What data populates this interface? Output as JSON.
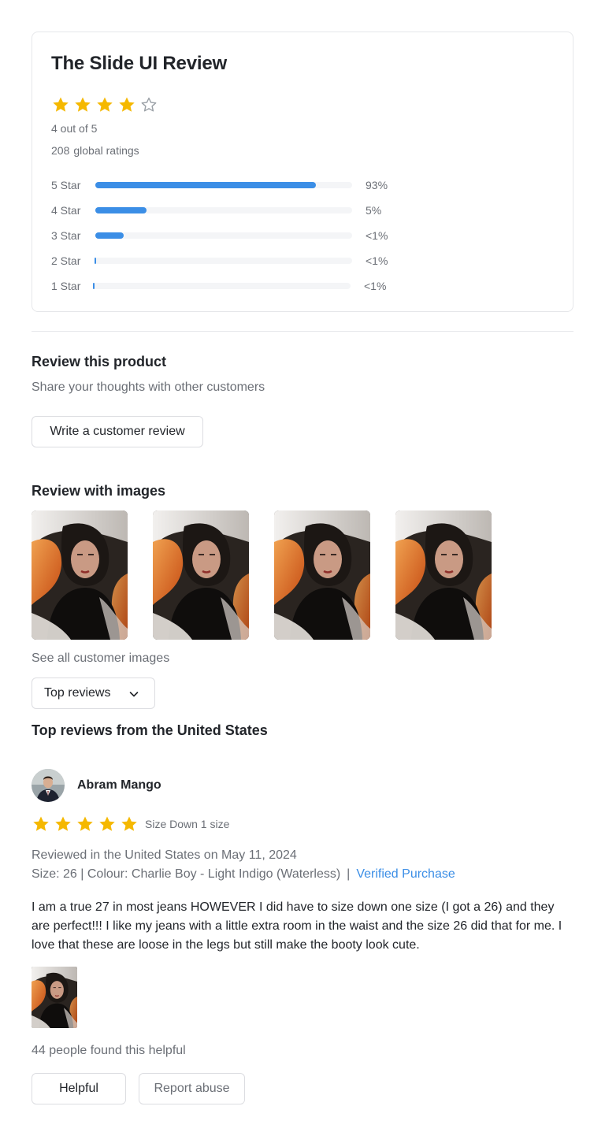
{
  "summary": {
    "title": "The Slide UI Review",
    "rating": 4,
    "max_rating": 5,
    "rating_text": "4 out of 5",
    "ratings_count": "208",
    "ratings_suffix": "global ratings",
    "star_color": "#f5b800",
    "bars": [
      {
        "label": "5 Star",
        "percent_text": "93%",
        "fraction": 0.86
      },
      {
        "label": "4 Star",
        "percent_text": "5%",
        "fraction": 0.2
      },
      {
        "label": "3 Star",
        "percent_text": "<1%",
        "fraction": 0.11
      },
      {
        "label": "2 Star",
        "percent_text": "<1%",
        "fraction": 0.005
      },
      {
        "label": "1 Star",
        "percent_text": "<1%",
        "fraction": 0.005
      }
    ],
    "bar_color": "#3b8ee6"
  },
  "review_product": {
    "heading": "Review this product",
    "subtext": "Share your thoughts with other customers",
    "write_button": "Write a customer review"
  },
  "images_section": {
    "heading": "Review with images",
    "see_all": "See all customer images"
  },
  "sort": {
    "selected": "Top reviews"
  },
  "top_reviews_heading": "Top reviews from the United States",
  "review": {
    "name": "Abram Mango",
    "rating": 5,
    "size_note": "Size Down 1 size",
    "reviewed_in": "Reviewed in the United States on May 11, 2024",
    "size_colour": "Size: 26 | Colour: Charlie Boy - Light Indigo (Waterless)",
    "separator": "|",
    "verified": "Verified Purchase",
    "body": "I am a true 27 in most jeans HOWEVER I did have to size down one size (I got a 26) and they are perfect!!! I like my jeans with a little extra room in the waist and the size 26 did that for me. I love that these are loose in the legs but still make the booty look cute.",
    "helpful_count": "44 people found this helpful",
    "helpful_button": "Helpful",
    "report_button": "Report abuse"
  }
}
